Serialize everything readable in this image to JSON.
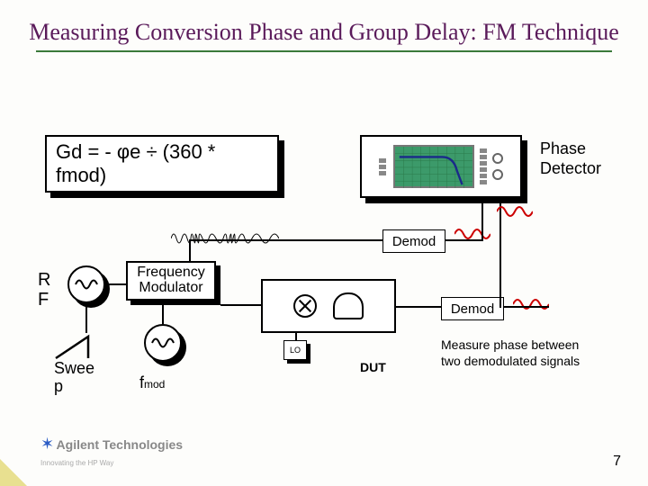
{
  "title": "Measuring Conversion Phase and Group Delay: FM Technique",
  "formula": "Gd = - φe ÷ (360 * fmod)",
  "labels": {
    "phase_detector": "Phase\nDetector",
    "rf": "R\nF",
    "freq_modulator": "Frequency\nModulator",
    "sweep": "Swee\np",
    "fmod_prefix": "f",
    "fmod_sub": "mod",
    "lo": "LO",
    "dut": "DUT",
    "demod": "Demod",
    "measure": "Measure phase between\ntwo demodulated signals"
  },
  "footer": {
    "company": "Agilent Technologies",
    "tagline": "Innovating the HP Way",
    "page": "7"
  }
}
